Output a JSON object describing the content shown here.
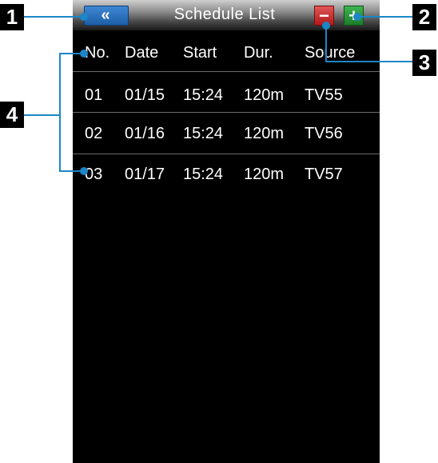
{
  "title": "Schedule List",
  "buttons": {
    "back_icon": "«",
    "minus_icon": "−",
    "plus_icon": "+"
  },
  "columns": [
    "No.",
    "Date",
    "Start",
    "Dur.",
    "Source"
  ],
  "rows": [
    [
      "01",
      "01/15",
      "15:24",
      "120m",
      "TV55"
    ],
    [
      "02",
      "01/16",
      "15:24",
      "120m",
      "TV56"
    ],
    [
      "03",
      "01/17",
      "15:24",
      "120m",
      "TV57"
    ]
  ],
  "callouts": [
    "1",
    "2",
    "3",
    "4"
  ],
  "colors": {
    "callout": "#1b86c8",
    "back": "#1d5ea7",
    "minus": "#b21a1a",
    "plus": "#1c7d2b"
  }
}
